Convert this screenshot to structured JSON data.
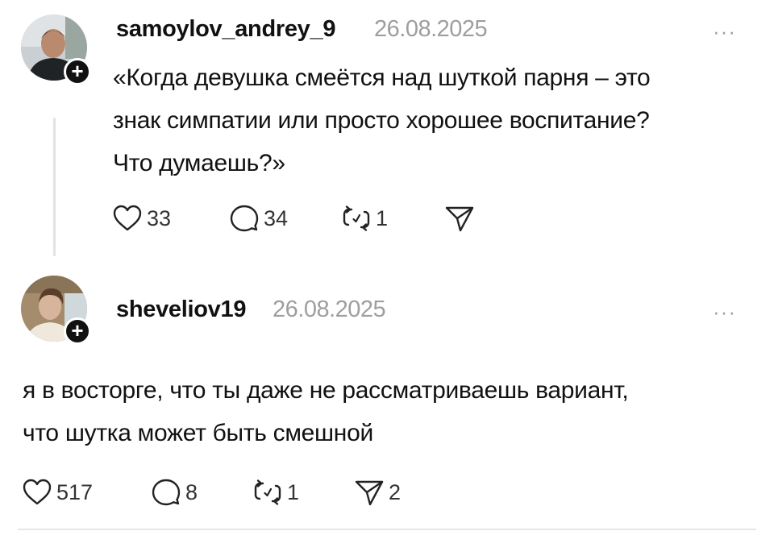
{
  "posts": [
    {
      "username": "samoylov_andrey_9",
      "date": "26.08.2025",
      "more_label": "···",
      "lines": [
        "«Когда девушка смеётся над шуткой парня – это",
        "знак симпатии или просто хорошее воспитание?",
        "Что думаешь?»"
      ],
      "likes": "33",
      "comments": "34",
      "reposts": "1",
      "shares": ""
    },
    {
      "username": "sheveliov19",
      "date": "26.08.2025",
      "more_label": "···",
      "lines": [
        "я в восторге, что ты даже не рассматриваешь вариант,",
        "что шутка может быть смешной"
      ],
      "likes": "517",
      "comments": "8",
      "reposts": "1",
      "shares": "2"
    }
  ],
  "icons": {
    "like": "heart-icon",
    "comment": "comment-bubble-icon",
    "repost": "repost-icon",
    "share": "send-icon",
    "follow": "plus-icon"
  },
  "colors": {
    "text": "#111111",
    "muted": "#9e9e9e",
    "divider": "#e6e6e6",
    "badge": "#111111"
  }
}
